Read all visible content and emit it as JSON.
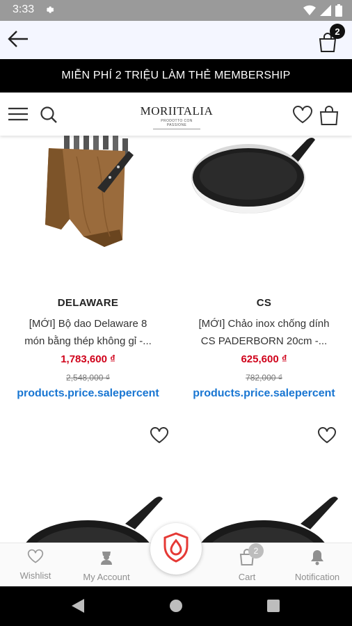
{
  "status_bar": {
    "time": "3:33"
  },
  "header": {
    "cart_count": "2"
  },
  "promo": {
    "text": "MIỄN PHÍ 2 TRIỆU LÀM THẺ MEMBERSHIP"
  },
  "logo": {
    "brand": "MORIITALIA",
    "tagline": "PRODOTTO CON PASSIONE"
  },
  "products": [
    {
      "brand": "DELAWARE",
      "name": "[MỚI] Bộ dao Delaware 8 món bằng thép không gỉ -...",
      "price": "1,783,600 ₫",
      "old_price": "2,548,000 ₫",
      "sale_percent": "products.price.salepercent"
    },
    {
      "brand": "CS",
      "name": "[MỚI] Chảo inox chống dính CS PADERBORN 20cm -...",
      "price": "625,600 ₫",
      "old_price": "782,000 ₫",
      "sale_percent": "products.price.salepercent"
    }
  ],
  "bottom_nav": {
    "wishlist": "Wishlist",
    "account": "My Account",
    "cart": "Cart",
    "cart_count": "2",
    "notification": "Notification"
  },
  "colors": {
    "price": "#d0021b",
    "sale_percent": "#1976d2",
    "shield": "#e53935",
    "promo_bg": "#000000"
  }
}
